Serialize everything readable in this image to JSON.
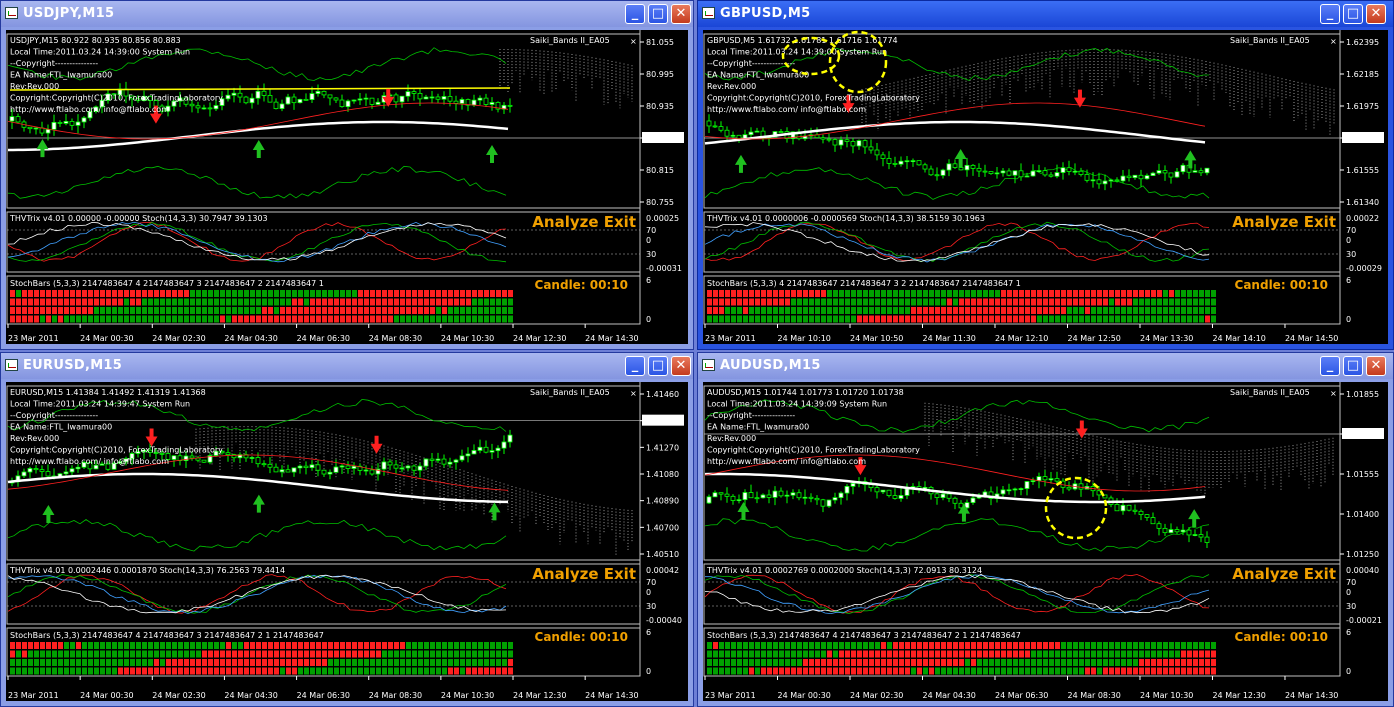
{
  "windows": [
    {
      "title": "USDJPY,M15",
      "active": false,
      "info_lines": [
        "USDJPY,M15  80.922 80.935 80.856 80.883",
        "Local Time:2011.03.24 14:39:00 System Run",
        "--Copyright---------------",
        "EA Name:FTL_Iwamura00",
        "Rev:Rev.000",
        "Copyright:Copyright(C)2010, ForexTradingLaboratory",
        "http://www.ftlabo.com/ info@ftlabo.com"
      ],
      "indicator_name": "Saiki_Bands II_EA05",
      "price_ticks": [
        "81.055",
        "80.995",
        "80.935",
        "80.883",
        "80.815",
        "80.755"
      ],
      "current_price": "80.883",
      "trix_label": "THVTrix v4.01 0.00000 -0.00000  Stoch(14,3,3) 30.7947 39.1303",
      "trix_ticks": [
        "0.00025",
        "70",
        "0",
        "30",
        "-0.00031"
      ],
      "stochbars_label": "StochBars (5,3,3) 2147483647 4 2147483647 3 2147483647 2 2147483647 1",
      "stoch_ticks": [
        "6",
        "0"
      ],
      "time_labels": [
        "23 Mar 2011",
        "24 Mar 00:30",
        "24 Mar 02:30",
        "24 Mar 04:30",
        "24 Mar 06:30",
        "24 Mar 08:30",
        "24 Mar 10:30",
        "24 Mar 12:30",
        "24 Mar 14:30"
      ]
    },
    {
      "title": "GBPUSD,M5",
      "active": true,
      "info_lines": [
        "GBPUSD,M5  1.61732 1.61781 1.61716 1.61774",
        "Local Time:2011.03.24 14:39:00 System Run",
        "--Copyright---------------",
        "EA Name:FTL_Iwamura00",
        "Rev:Rev.000",
        "Copyright:Copyright(C)2010, ForexTradingLaboratory",
        "http://www.ftlabo.com/ info@ftlabo.com"
      ],
      "indicator_name": "Saiki_Bands II_EA05",
      "price_ticks": [
        "1.62395",
        "1.62185",
        "1.61975",
        "1.61774",
        "1.61555",
        "1.61340"
      ],
      "current_price": "1.61774",
      "trix_label": "THVTrix v4.01 0.0000006 -0.0000569  Stoch(14,3,3) 38.5159 30.1963",
      "trix_ticks": [
        "0.00022",
        "70",
        "0",
        "30",
        "-0.00029"
      ],
      "stochbars_label": "StochBars (5,3,3) 4 2147483647 2147483647 3 2 2147483647 2147483647 1",
      "stoch_ticks": [
        "6",
        "0"
      ],
      "time_labels": [
        "23 Mar 2011",
        "24 Mar 10:10",
        "24 Mar 10:50",
        "24 Mar 11:30",
        "24 Mar 12:10",
        "24 Mar 12:50",
        "24 Mar 13:30",
        "24 Mar 14:10",
        "24 Mar 14:50"
      ]
    },
    {
      "title": "EURUSD,M15",
      "active": false,
      "info_lines": [
        "EURUSD,M15  1.41384 1.41492 1.41319 1.41368",
        "Local Time:2011.03.24 14:39:47 System Run",
        "--Copyright---------------",
        "EA Name:FTL_Iwamura00",
        "Rev:Rev.000",
        "Copyright:Copyright(C)2010, ForexTradingLaboratory",
        "http://www.ftlabo.com/ info@ftlabo.com"
      ],
      "indicator_name": "Saiki_Bands II_EA05",
      "price_ticks": [
        "1.41460",
        "1.41368",
        "1.41270",
        "1.41080",
        "1.40890",
        "1.40700",
        "1.40510"
      ],
      "current_price": "1.41368",
      "trix_label": "THVTrix v4.01 0.0002446 0.0001870  Stoch(14,3,3) 76.2563 79.4414",
      "trix_ticks": [
        "0.00042",
        "70",
        "0",
        "30",
        "-0.00040"
      ],
      "stochbars_label": "StochBars (5,3,3) 2147483647 4 2147483647 3 2147483647 2 1 2147483647",
      "stoch_ticks": [
        "6",
        "0"
      ],
      "time_labels": [
        "23 Mar 2011",
        "24 Mar 00:30",
        "24 Mar 02:30",
        "24 Mar 04:30",
        "24 Mar 06:30",
        "24 Mar 08:30",
        "24 Mar 10:30",
        "24 Mar 12:30",
        "24 Mar 14:30"
      ]
    },
    {
      "title": "AUDUSD,M15",
      "active": false,
      "info_lines": [
        "AUDUSD,M15  1.01744 1.01773 1.01720 1.01738",
        "Local Time:2011.03.24 14:39:09 System Run",
        "--Copyright---------------",
        "EA Name:FTL_Iwamura00",
        "Rev:Rev.000",
        "Copyright:Copyright(C)2010, ForexTradingLaboratory",
        "http://www.ftlabo.com/ info@ftlabo.com"
      ],
      "indicator_name": "Saiki_Bands II_EA05",
      "price_ticks": [
        "1.01855",
        "1.01738",
        "1.01555",
        "1.01400",
        "1.01250"
      ],
      "current_price": "1.01738",
      "trix_label": "THVTrix v4.01 0.0002769 0.0002000  Stoch(14,3,3) 72.0913 80.3124",
      "trix_ticks": [
        "0.00040",
        "70",
        "0",
        "30",
        "-0.00021"
      ],
      "stochbars_label": "StochBars (5,3,3) 2147483647 4 2147483647 3 2147483647 2 1 2147483647",
      "stoch_ticks": [
        "6",
        "0"
      ],
      "time_labels": [
        "23 Mar 2011",
        "24 Mar 00:30",
        "24 Mar 02:30",
        "24 Mar 04:30",
        "24 Mar 06:30",
        "24 Mar 08:30",
        "24 Mar 10:30",
        "24 Mar 12:30",
        "24 Mar 14:30"
      ]
    }
  ],
  "analyze_label": "Analyze Exit",
  "candle_label": "Candle:  00:10",
  "buttons": {
    "minimize": "_",
    "maximize": "□",
    "close": "✕"
  },
  "icons": {
    "window": "chart-window-icon",
    "arrow_up": "arrow-up-icon",
    "arrow_down": "arrow-down-icon"
  },
  "colors": {
    "bull": "#00ff00",
    "bear": "#ff0000",
    "ma": "#ffffff",
    "accent": "#f0a000",
    "yellow": "#ffff00",
    "grid": "#c0c0c0"
  }
}
